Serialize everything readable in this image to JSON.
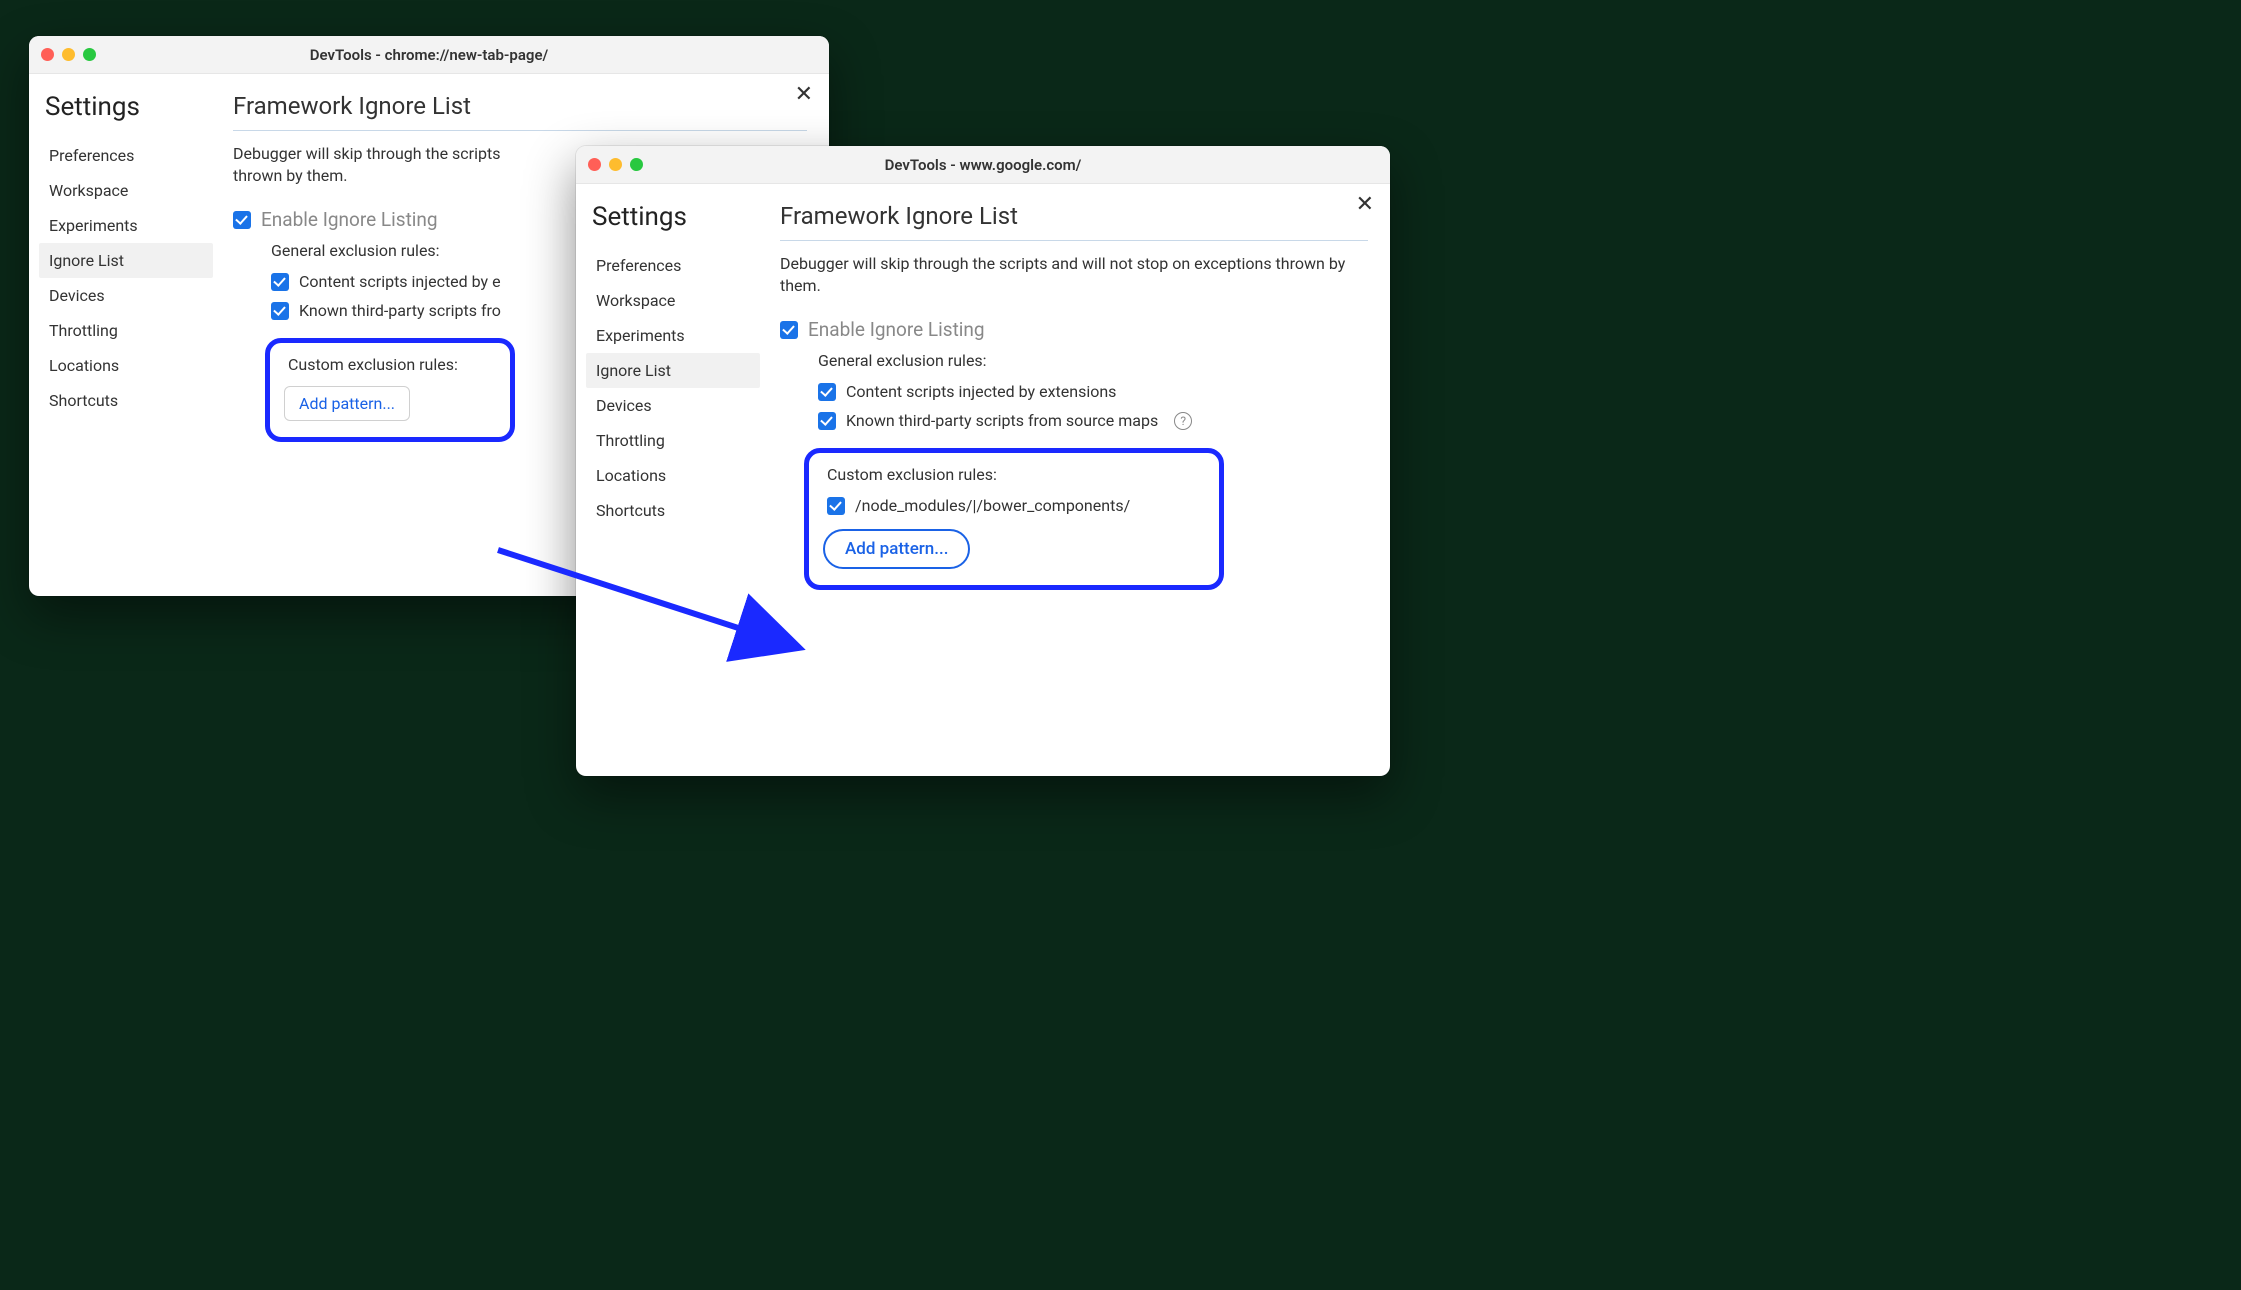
{
  "windows": {
    "a": {
      "title": "DevTools - chrome://new-tab-page/",
      "settings_title": "Settings",
      "sidebar": [
        "Preferences",
        "Workspace",
        "Experiments",
        "Ignore List",
        "Devices",
        "Throttling",
        "Locations",
        "Shortcuts"
      ],
      "active_index": 3,
      "heading": "Framework Ignore List",
      "desc": "Debugger will skip through the scripts and will not stop on exceptions thrown by them.",
      "desc_cut": "Debugger will skip through the scripts\nthrown by them.",
      "enable_label": "Enable Ignore Listing",
      "section_general": "General exclusion rules:",
      "rule_content": "Content scripts injected by extensions",
      "rule_content_cut": "Content scripts injected by e",
      "rule_known": "Known third-party scripts from source maps",
      "rule_known_cut": "Known third-party scripts fro",
      "custom_header": "Custom exclusion rules:",
      "add_pattern": "Add pattern..."
    },
    "b": {
      "title": "DevTools - www.google.com/",
      "settings_title": "Settings",
      "sidebar": [
        "Preferences",
        "Workspace",
        "Experiments",
        "Ignore List",
        "Devices",
        "Throttling",
        "Locations",
        "Shortcuts"
      ],
      "active_index": 3,
      "heading": "Framework Ignore List",
      "desc": "Debugger will skip through the scripts and will not stop on exceptions thrown by them.",
      "enable_label": "Enable Ignore Listing",
      "section_general": "General exclusion rules:",
      "rule_content": "Content scripts injected by extensions",
      "rule_known": "Known third-party scripts from source maps",
      "custom_header": "Custom exclusion rules:",
      "custom_pattern": "/node_modules/|/bower_components/",
      "add_pattern": "Add pattern..."
    }
  }
}
